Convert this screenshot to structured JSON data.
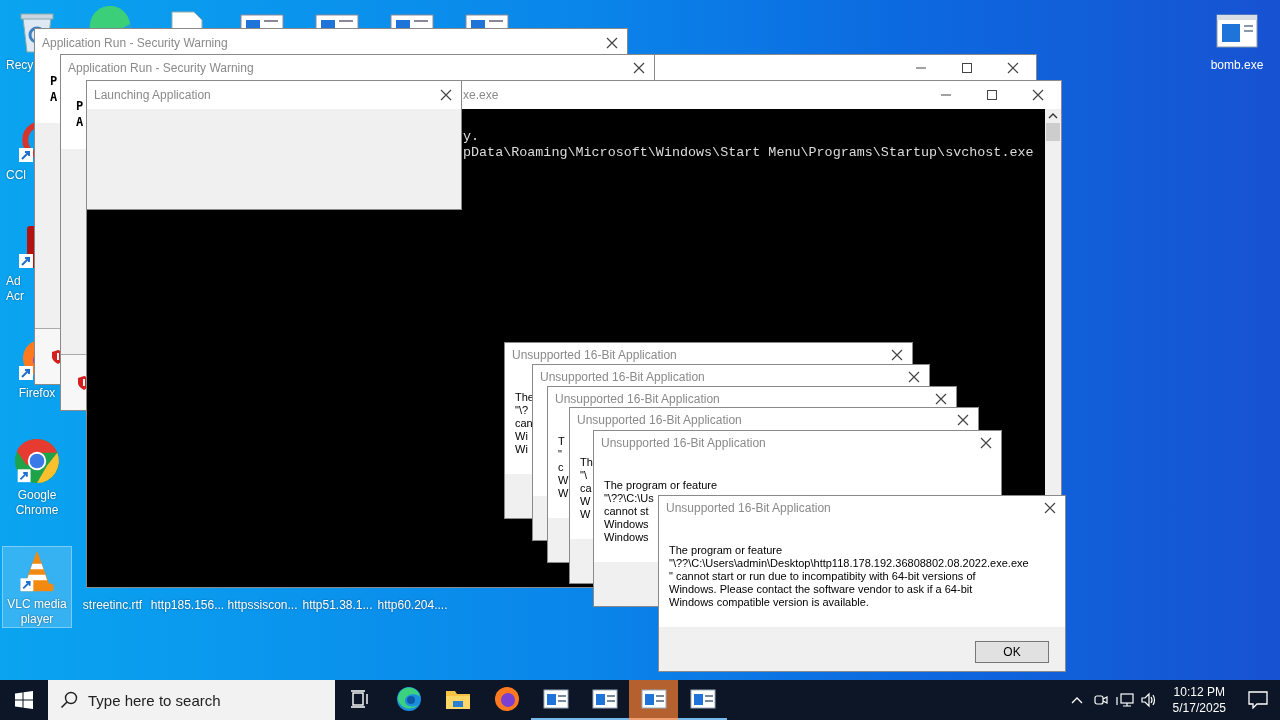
{
  "desktop_icons": [
    {
      "kind": "recycle",
      "lines": [
        "Recy"
      ],
      "selected": false
    },
    {
      "kind": "ccleaner",
      "lines": [
        "CCl"
      ],
      "selected": false
    },
    {
      "kind": "acrobat",
      "lines": [
        "Ad",
        "Acr"
      ],
      "selected": false
    },
    {
      "kind": "firefox",
      "lines": [
        "Firefox"
      ],
      "selected": false
    },
    {
      "kind": "chrome",
      "lines": [
        "Google",
        "Chrome"
      ],
      "selected": false
    },
    {
      "kind": "vlc",
      "lines": [
        "VLC media",
        "player"
      ],
      "selected": true
    }
  ],
  "file_labels": [
    "streetinc.rtf",
    "http185.156...",
    "httpssiscon...",
    "http51.38.1...",
    "http60.204...."
  ],
  "right_icon": {
    "label": "bomb.exe"
  },
  "security_windows": [
    {
      "title": "Application Run - Security Warning",
      "lines": [
        "P",
        "A"
      ]
    },
    {
      "title": "Application Run - Security Warning",
      "lines": [
        "P",
        "A"
      ]
    }
  ],
  "console": {
    "title": "xe.exe",
    "lines": [
      "y.",
      "pData\\Roaming\\Microsoft\\Windows\\Start Menu\\Programs\\Startup\\svchost.exe"
    ]
  },
  "launching": {
    "title": "Launching Application"
  },
  "dialogs": [
    {
      "title": "Unsupported 16-Bit Application",
      "lines": [
        "The",
        "\"\\?",
        "can",
        "Wi",
        "Wi"
      ]
    },
    {
      "title": "Unsupported 16-Bit Application"
    },
    {
      "title": "Unsupported 16-Bit Application",
      "lines": [
        "T",
        "\"",
        "c",
        "W",
        "W"
      ]
    },
    {
      "title": "Unsupported 16-Bit Application",
      "lines": [
        "Th",
        "\"\\",
        "ca",
        "W",
        "W"
      ]
    },
    {
      "title": "Unsupported 16-Bit Application",
      "lines": [
        "The program or feature",
        "\"\\??\\C:\\Us",
        "cannot st",
        "Windows",
        "Windows"
      ]
    },
    {
      "title": "Unsupported 16-Bit Application",
      "lines": [
        "The program or feature",
        "\"\\??\\C:\\Users\\admin\\Desktop\\http118.178.192.36808802.08.2022.exe.exe",
        "\" cannot start or run due to incompatibity with 64-bit versions of",
        "Windows. Please contact the software vendor to ask if a 64-bit",
        "Windows compatible version is available."
      ],
      "button": "OK"
    }
  ],
  "taskbar": {
    "search_placeholder": "Type here to search",
    "apps": [
      {
        "kind": "taskview",
        "running": false,
        "selected": false
      },
      {
        "kind": "edge",
        "running": false,
        "selected": false
      },
      {
        "kind": "folder",
        "running": false,
        "selected": false
      },
      {
        "kind": "firefox",
        "running": false,
        "selected": false
      },
      {
        "kind": "app",
        "running": true,
        "selected": false
      },
      {
        "kind": "app",
        "running": true,
        "selected": false
      },
      {
        "kind": "app",
        "running": true,
        "selected": true
      },
      {
        "kind": "app",
        "running": true,
        "selected": false
      }
    ],
    "time": "10:12 PM",
    "date": "5/17/2025"
  }
}
